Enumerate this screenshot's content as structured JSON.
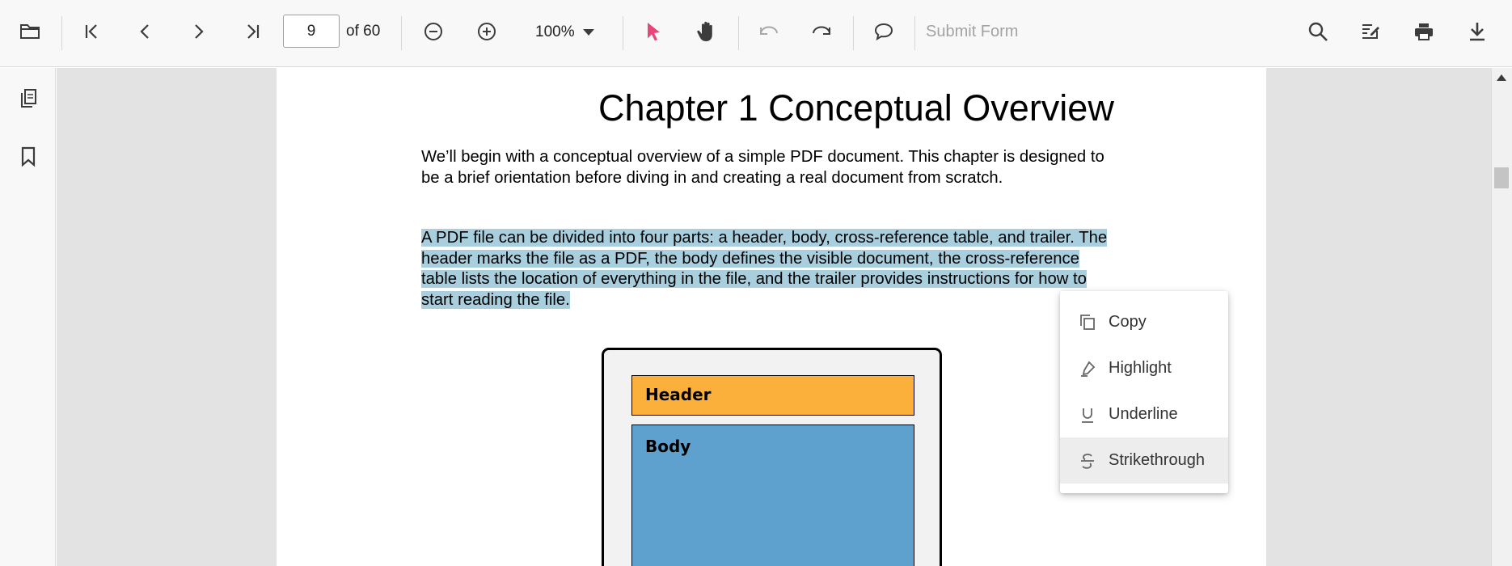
{
  "toolbar": {
    "open_label": "Open",
    "page_number": "9",
    "page_total_text": "of 60",
    "zoom_value": "100%",
    "submit_form_label": "Submit Form",
    "icons": [
      "folder-icon",
      "first-page-icon",
      "previous-page-icon",
      "next-page-icon",
      "last-page-icon",
      "zoom-out-icon",
      "zoom-in-icon",
      "chevron-down-icon",
      "selection-cursor-icon",
      "pan-hand-icon",
      "undo-icon",
      "redo-icon",
      "comment-icon",
      "search-icon",
      "edit-annotation-icon",
      "print-icon",
      "download-icon"
    ]
  },
  "sidebar": {
    "icons": [
      "page-thumbnails-icon",
      "bookmark-icon"
    ]
  },
  "document": {
    "chapter_title": "Chapter 1  Conceptual Overview",
    "paragraph1": "We’ll begin with a conceptual overview of a simple PDF document. This chapter is designed to be a brief orientation before diving in and creating a real document from scratch.",
    "paragraph2": "A PDF file can be divided into four parts: a header, body, cross-reference table, and trailer. The header marks the file as a PDF, the body defines the visible document, the cross-reference table lists the location of everything in the file, and the trailer provides instructions for how to start reading the file.",
    "diagram": {
      "header_label": "Header",
      "body_label": "Body"
    }
  },
  "context_menu": {
    "items": [
      {
        "label": "Copy",
        "icon": "copy-icon"
      },
      {
        "label": "Highlight",
        "icon": "highlight-icon"
      },
      {
        "label": "Underline",
        "icon": "underline-icon"
      },
      {
        "label": "Strikethrough",
        "icon": "strikethrough-icon"
      }
    ]
  },
  "colors": {
    "selection": "#a9cfde",
    "accent_pointer": "#e8457a",
    "diagram_header": "#fbb03b",
    "diagram_body": "#5ea1cf"
  }
}
